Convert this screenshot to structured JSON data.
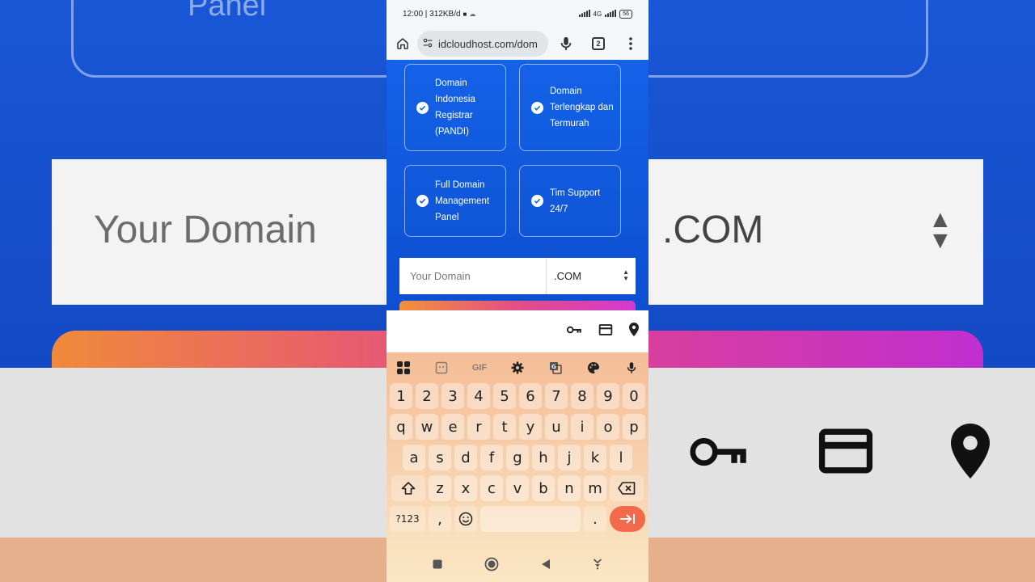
{
  "status": {
    "time_speed": "12:00 | 312KB/d",
    "battery": "56",
    "net": "4G"
  },
  "browser": {
    "url": "idcloudhost.com/dom",
    "tab_count": "2"
  },
  "features": [
    {
      "label": "Domain Indonesia Registrar (PANDI)"
    },
    {
      "label": "Domain Terlengkap dan Termurah"
    },
    {
      "label": "Full Domain Management Panel"
    },
    {
      "label": "Tim Support 24/7"
    }
  ],
  "domain_search": {
    "placeholder": "Your Domain",
    "tld": ".COM"
  },
  "background": {
    "frame_text": "Panel",
    "input_placeholder": "Your Domain",
    "tld": ".COM"
  },
  "keyboard": {
    "toolbar_gif": "GIF",
    "row_numbers": [
      "1",
      "2",
      "3",
      "4",
      "5",
      "6",
      "7",
      "8",
      "9",
      "0"
    ],
    "row_q": [
      "q",
      "w",
      "e",
      "r",
      "t",
      "y",
      "u",
      "i",
      "o",
      "p"
    ],
    "row_a": [
      "a",
      "s",
      "d",
      "f",
      "g",
      "h",
      "j",
      "k",
      "l"
    ],
    "row_z": [
      "z",
      "x",
      "c",
      "v",
      "b",
      "n",
      "m"
    ],
    "symbols_key": "?123",
    "comma_key": ",",
    "period_key": "."
  },
  "colors": {
    "site_blue": "#1462e8",
    "enter": "#f26a4b"
  }
}
